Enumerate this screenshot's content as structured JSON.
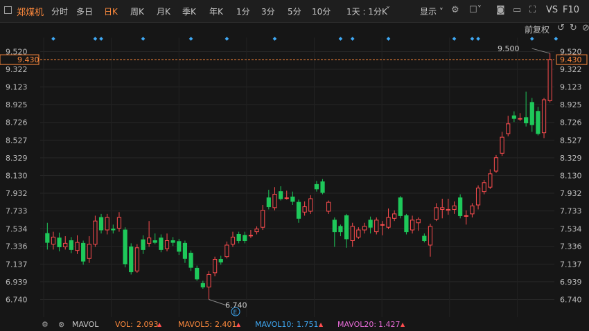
{
  "toolbar": {
    "title": "郑煤机",
    "tabs": [
      {
        "label": "分时",
        "active": false
      },
      {
        "label": "多日",
        "active": false
      },
      {
        "label": "日K",
        "active": true
      },
      {
        "label": "周K",
        "active": false
      },
      {
        "label": "月K",
        "active": false
      },
      {
        "label": "季K",
        "active": false
      },
      {
        "label": "年K",
        "active": false
      },
      {
        "label": "1分",
        "active": false
      },
      {
        "label": "3分",
        "active": false
      },
      {
        "label": "5分",
        "active": false
      },
      {
        "label": "10分",
        "active": false
      },
      {
        "label": "1天 : 1分K",
        "active": false
      }
    ],
    "display_label": "显示",
    "vs_label": "VS",
    "f10_label": "F10"
  },
  "restore_label": "前复权",
  "colors": {
    "up": "#ff4d4f",
    "down": "#1ec85a",
    "accent": "#ff8a3d",
    "vol": "#ff8a3d",
    "mavol5": "#ff8a3d",
    "mavol10": "#3fa9f5",
    "mavol20": "#e86bd8"
  },
  "indicator": {
    "name": "MAVOL",
    "vol_label": "VOL:",
    "vol_value": "2.093",
    "mavol5_label": "MAVOL5:",
    "mavol5_value": "2.401",
    "mavol10_label": "MAVOL10:",
    "mavol10_value": "1.751",
    "mavol20_label": "MAVOL20:",
    "mavol20_value": "1.427"
  },
  "chart_data": {
    "type": "candlestick",
    "y_ticks": [
      "9.520",
      "9.322",
      "9.123",
      "8.925",
      "8.726",
      "8.527",
      "8.329",
      "8.130",
      "7.932",
      "7.733",
      "7.534",
      "7.336",
      "7.137",
      "6.939",
      "6.740"
    ],
    "ylim": [
      6.74,
      9.52
    ],
    "current_price": "9.430",
    "max_label": "9.500",
    "min_label": "6.740",
    "event_marker": "E",
    "grid": true,
    "candles": [
      {
        "o": 7.48,
        "c": 7.38,
        "h": 7.6,
        "l": 7.3
      },
      {
        "o": 7.36,
        "c": 7.44,
        "h": 7.5,
        "l": 7.3
      },
      {
        "o": 7.43,
        "c": 7.33,
        "h": 7.49,
        "l": 7.28
      },
      {
        "o": 7.33,
        "c": 7.37,
        "h": 7.45,
        "l": 7.3
      },
      {
        "o": 7.4,
        "c": 7.3,
        "h": 7.44,
        "l": 7.26
      },
      {
        "o": 7.29,
        "c": 7.38,
        "h": 7.46,
        "l": 7.25
      },
      {
        "o": 7.37,
        "c": 7.17,
        "h": 7.4,
        "l": 7.13
      },
      {
        "o": 7.2,
        "c": 7.36,
        "h": 7.45,
        "l": 7.15
      },
      {
        "o": 7.36,
        "c": 7.62,
        "h": 7.68,
        "l": 7.33
      },
      {
        "o": 7.66,
        "c": 7.52,
        "h": 7.7,
        "l": 7.48
      },
      {
        "o": 7.52,
        "c": 7.66,
        "h": 7.7,
        "l": 7.47
      },
      {
        "o": 7.53,
        "c": 7.52,
        "h": 7.58,
        "l": 7.48
      },
      {
        "o": 7.54,
        "c": 7.66,
        "h": 7.72,
        "l": 7.5
      },
      {
        "o": 7.52,
        "c": 7.14,
        "h": 7.55,
        "l": 7.1
      },
      {
        "o": 7.33,
        "c": 7.05,
        "h": 7.37,
        "l": 7.02
      },
      {
        "o": 7.06,
        "c": 7.32,
        "h": 7.36,
        "l": 7.04
      },
      {
        "o": 7.41,
        "c": 7.3,
        "h": 7.46,
        "l": 7.25
      },
      {
        "o": 7.37,
        "c": 7.43,
        "h": 7.62,
        "l": 7.33
      },
      {
        "o": 7.4,
        "c": 7.38,
        "h": 7.48,
        "l": 7.36
      },
      {
        "o": 7.43,
        "c": 7.3,
        "h": 7.47,
        "l": 7.27
      },
      {
        "o": 7.31,
        "c": 7.4,
        "h": 7.48,
        "l": 7.28
      },
      {
        "o": 7.4,
        "c": 7.38,
        "h": 7.44,
        "l": 7.34
      },
      {
        "o": 7.39,
        "c": 7.28,
        "h": 7.42,
        "l": 7.24
      },
      {
        "o": 7.37,
        "c": 7.2,
        "h": 7.4,
        "l": 7.15
      },
      {
        "o": 7.26,
        "c": 7.1,
        "h": 7.29,
        "l": 7.06
      },
      {
        "o": 7.09,
        "c": 6.97,
        "h": 7.12,
        "l": 6.95
      },
      {
        "o": 6.92,
        "c": 6.88,
        "h": 6.95,
        "l": 6.86
      },
      {
        "o": 6.88,
        "c": 7.02,
        "h": 7.06,
        "l": 6.74
      },
      {
        "o": 7.04,
        "c": 7.19,
        "h": 7.22,
        "l": 7.0
      },
      {
        "o": 7.19,
        "c": 7.16,
        "h": 7.23,
        "l": 7.13
      },
      {
        "o": 7.22,
        "c": 7.35,
        "h": 7.39,
        "l": 7.2
      },
      {
        "o": 7.36,
        "c": 7.44,
        "h": 7.5,
        "l": 7.33
      },
      {
        "o": 7.47,
        "c": 7.4,
        "h": 7.5,
        "l": 7.37
      },
      {
        "o": 7.46,
        "c": 7.4,
        "h": 7.5,
        "l": 7.37
      },
      {
        "o": 7.46,
        "c": 7.46,
        "h": 7.52,
        "l": 7.43
      },
      {
        "o": 7.5,
        "c": 7.53,
        "h": 7.56,
        "l": 7.47
      },
      {
        "o": 7.55,
        "c": 7.74,
        "h": 7.8,
        "l": 7.52
      },
      {
        "o": 7.88,
        "c": 7.78,
        "h": 7.97,
        "l": 7.75
      },
      {
        "o": 7.77,
        "c": 7.92,
        "h": 8.0,
        "l": 7.74
      },
      {
        "o": 7.95,
        "c": 7.87,
        "h": 8.01,
        "l": 7.85
      },
      {
        "o": 7.88,
        "c": 7.88,
        "h": 7.96,
        "l": 7.86
      },
      {
        "o": 7.89,
        "c": 7.84,
        "h": 7.95,
        "l": 7.8
      },
      {
        "o": 7.83,
        "c": 7.65,
        "h": 7.86,
        "l": 7.6
      },
      {
        "o": 7.72,
        "c": 7.78,
        "h": 7.84,
        "l": 7.68
      },
      {
        "o": 7.73,
        "c": 7.87,
        "h": 7.91,
        "l": 7.7
      },
      {
        "o": 8.03,
        "c": 7.98,
        "h": 8.07,
        "l": 7.95
      },
      {
        "o": 8.06,
        "c": 7.94,
        "h": 8.09,
        "l": 7.92
      },
      {
        "o": 7.73,
        "c": 7.83,
        "h": 7.85,
        "l": 7.7
      },
      {
        "o": 7.63,
        "c": 7.5,
        "h": 7.66,
        "l": 7.33
      },
      {
        "o": 7.56,
        "c": 7.5,
        "h": 7.58,
        "l": 7.45
      },
      {
        "o": 7.68,
        "c": 7.42,
        "h": 7.7,
        "l": 7.32
      },
      {
        "o": 7.4,
        "c": 7.56,
        "h": 7.6,
        "l": 7.33
      },
      {
        "o": 7.44,
        "c": 7.52,
        "h": 7.55,
        "l": 7.42
      },
      {
        "o": 7.52,
        "c": 7.56,
        "h": 7.6,
        "l": 7.48
      },
      {
        "o": 7.63,
        "c": 7.55,
        "h": 7.67,
        "l": 7.48
      },
      {
        "o": 7.5,
        "c": 7.63,
        "h": 7.66,
        "l": 7.47
      },
      {
        "o": 7.58,
        "c": 7.58,
        "h": 7.62,
        "l": 7.46
      },
      {
        "o": 7.55,
        "c": 7.66,
        "h": 7.76,
        "l": 7.53
      },
      {
        "o": 7.65,
        "c": 7.7,
        "h": 7.74,
        "l": 7.62
      },
      {
        "o": 7.88,
        "c": 7.68,
        "h": 7.9,
        "l": 7.65
      },
      {
        "o": 7.68,
        "c": 7.5,
        "h": 7.7,
        "l": 7.47
      },
      {
        "o": 7.52,
        "c": 7.63,
        "h": 7.68,
        "l": 7.48
      },
      {
        "o": 7.6,
        "c": 7.64,
        "h": 7.66,
        "l": 7.51
      },
      {
        "o": 7.45,
        "c": 7.4,
        "h": 7.48,
        "l": 7.38
      },
      {
        "o": 7.35,
        "c": 7.56,
        "h": 7.59,
        "l": 7.22
      },
      {
        "o": 7.64,
        "c": 7.77,
        "h": 7.82,
        "l": 7.62
      },
      {
        "o": 7.75,
        "c": 7.77,
        "h": 7.87,
        "l": 7.65
      },
      {
        "o": 7.74,
        "c": 7.75,
        "h": 7.87,
        "l": 7.69
      },
      {
        "o": 7.75,
        "c": 7.79,
        "h": 7.84,
        "l": 7.7
      },
      {
        "o": 7.88,
        "c": 7.68,
        "h": 7.92,
        "l": 7.65
      },
      {
        "o": 7.68,
        "c": 7.68,
        "h": 7.74,
        "l": 7.58
      },
      {
        "o": 7.7,
        "c": 7.79,
        "h": 7.82,
        "l": 7.66
      },
      {
        "o": 7.8,
        "c": 7.99,
        "h": 8.02,
        "l": 7.75
      },
      {
        "o": 7.95,
        "c": 8.05,
        "h": 8.08,
        "l": 7.92
      },
      {
        "o": 8.0,
        "c": 8.15,
        "h": 8.2,
        "l": 7.98
      },
      {
        "o": 8.18,
        "c": 8.33,
        "h": 8.36,
        "l": 8.16
      },
      {
        "o": 8.38,
        "c": 8.56,
        "h": 8.62,
        "l": 8.35
      },
      {
        "o": 8.6,
        "c": 8.71,
        "h": 8.8,
        "l": 8.57
      },
      {
        "o": 8.8,
        "c": 8.77,
        "h": 8.85,
        "l": 8.73
      },
      {
        "o": 8.77,
        "c": 8.77,
        "h": 8.83,
        "l": 8.74
      },
      {
        "o": 8.78,
        "c": 8.72,
        "h": 9.07,
        "l": 8.68
      },
      {
        "o": 8.95,
        "c": 8.7,
        "h": 9.0,
        "l": 8.62
      },
      {
        "o": 8.85,
        "c": 8.6,
        "h": 8.9,
        "l": 8.58
      },
      {
        "o": 8.61,
        "c": 8.98,
        "h": 9.0,
        "l": 8.55
      },
      {
        "o": 8.97,
        "c": 9.43,
        "h": 9.5,
        "l": 8.95
      }
    ],
    "event_candles": [
      1,
      8,
      9,
      16,
      24,
      30,
      38,
      49,
      51,
      57,
      68,
      71,
      72,
      81,
      85
    ]
  }
}
